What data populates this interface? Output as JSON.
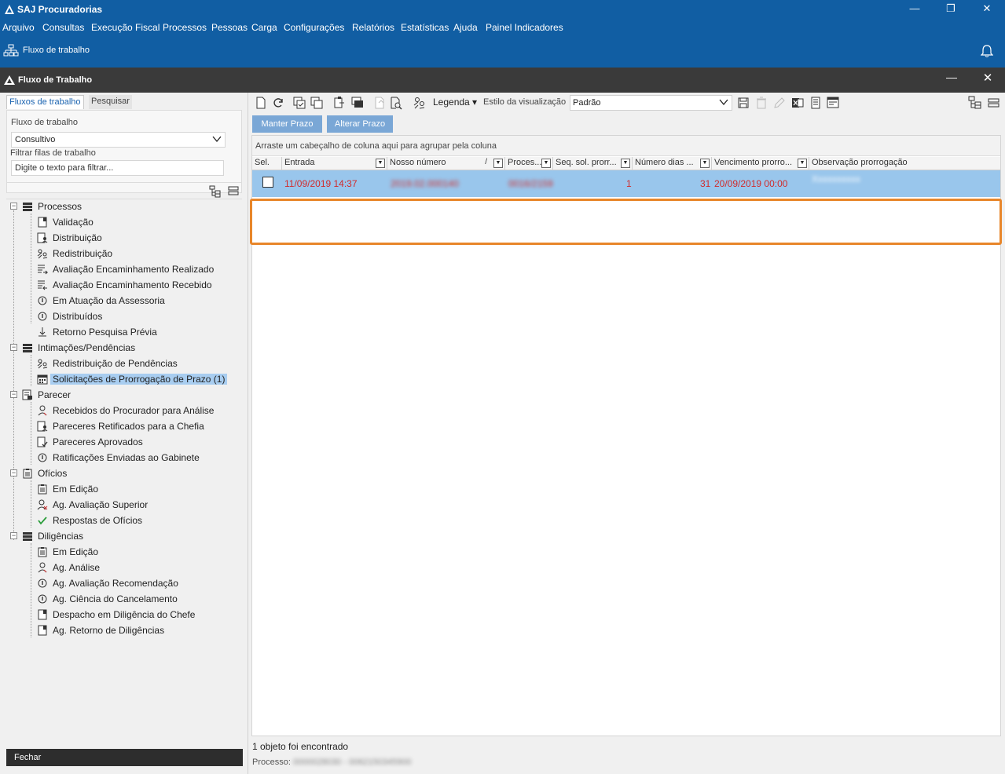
{
  "window": {
    "app_title": "SAJ Procuradorias",
    "minimize": "—",
    "maximize": "❐",
    "close": "✕"
  },
  "menu": [
    "Arquivo",
    "Consultas",
    "Execução Fiscal",
    "Processos",
    "Pessoas",
    "Carga",
    "Configurações",
    "Relatórios",
    "Estatísticas",
    "Ajuda",
    "Painel Indicadores"
  ],
  "strip": {
    "label": "Fluxo de trabalho"
  },
  "inner_window": {
    "title": "Fluxo de Trabalho",
    "minimize": "—",
    "close": "✕"
  },
  "left": {
    "tabs": [
      "Fluxos de trabalho",
      "Pesquisar"
    ],
    "workflow_label": "Fluxo de trabalho",
    "workflow_value": "Consultivo",
    "filter_label": "Filtrar filas de trabalho",
    "filter_placeholder": "Digite o texto para filtrar...",
    "tree": [
      {
        "label": "Processos",
        "level": 0,
        "icon": "list-icon"
      },
      {
        "label": "Validação",
        "level": 1,
        "icon": "document-flag-icon"
      },
      {
        "label": "Distribuição",
        "level": 1,
        "icon": "document-person-icon"
      },
      {
        "label": "Redistribuição",
        "level": 1,
        "icon": "people-swap-icon"
      },
      {
        "label": "Avaliação Encaminhamento Realizado",
        "level": 1,
        "icon": "list-arrow-out-icon"
      },
      {
        "label": "Avaliação Encaminhamento Recebido",
        "level": 1,
        "icon": "list-arrow-in-icon"
      },
      {
        "label": "Em Atuação da Assessoria",
        "level": 1,
        "icon": "info-circle-icon"
      },
      {
        "label": "Distribuídos",
        "level": 1,
        "icon": "info-circle-icon"
      },
      {
        "label": "Retorno Pesquisa Prévia",
        "level": 1,
        "icon": "download-arrow-icon"
      },
      {
        "label": "Intimações/Pendências",
        "level": 0,
        "icon": "list-icon"
      },
      {
        "label": "Redistribuição de Pendências",
        "level": 1,
        "icon": "people-swap-icon"
      },
      {
        "label": "Solicitações de Prorrogação de Prazo (1)",
        "level": 1,
        "icon": "calendar-icon",
        "selected": true
      },
      {
        "label": "Parecer",
        "level": 0,
        "icon": "document-edit-icon"
      },
      {
        "label": "Recebidos do Procurador para Análise",
        "level": 1,
        "icon": "person-icon"
      },
      {
        "label": "Pareceres Retificados para a Chefia",
        "level": 1,
        "icon": "document-person-icon"
      },
      {
        "label": "Pareceres Aprovados",
        "level": 1,
        "icon": "document-check-icon"
      },
      {
        "label": "Ratificações Enviadas ao Gabinete",
        "level": 1,
        "icon": "info-circle-icon"
      },
      {
        "label": "Ofícios",
        "level": 0,
        "icon": "clipboard-icon"
      },
      {
        "label": "Em Edição",
        "level": 1,
        "icon": "clipboard-icon"
      },
      {
        "label": "Ag. Avaliação Superior",
        "level": 1,
        "icon": "person-x-icon"
      },
      {
        "label": "Respostas de Ofícios",
        "level": 1,
        "icon": "checkmark-icon"
      },
      {
        "label": "Diligências",
        "level": 0,
        "icon": "list-icon"
      },
      {
        "label": "Em Edição",
        "level": 1,
        "icon": "clipboard-icon"
      },
      {
        "label": "Ag. Análise",
        "level": 1,
        "icon": "person-icon"
      },
      {
        "label": "Ag. Avaliação Recomendação",
        "level": 1,
        "icon": "info-circle-icon"
      },
      {
        "label": "Ag. Ciência do Cancelamento",
        "level": 1,
        "icon": "info-circle-icon"
      },
      {
        "label": "Despacho em Diligência do Chefe",
        "level": 1,
        "icon": "document-flag-icon"
      },
      {
        "label": "Ag. Retorno de Diligências",
        "level": 1,
        "icon": "document-flag-icon"
      }
    ],
    "close_button": "Fechar"
  },
  "right": {
    "legend_label": "Legenda ▾",
    "style_label": "Estilo da visualização",
    "style_value": "Padrão",
    "buttons": [
      "Manter Prazo",
      "Alterar Prazo"
    ],
    "group_hint": "Arraste um cabeçalho de coluna aqui para agrupar pela coluna",
    "columns": [
      "Sel.",
      "Entrada",
      "Nosso número",
      "Proces...",
      "Seq. sol. prorr...",
      "Número dias ...",
      "Vencimento prorro...",
      "Observação prorrogação"
    ],
    "row": {
      "entrada": "11/09/2019 14:37",
      "nosso_numero": "2019.02.000140",
      "processo": "0016/2159",
      "seq": "1",
      "numero_dias": "31",
      "vencimento": "20/09/2019 00:00",
      "observacao": "Xxxxxxxxxx"
    },
    "status": "1 objeto foi encontrado",
    "process_label": "Processo:",
    "process_value": "0000028030 - 0062150345900"
  },
  "colors": {
    "title_blue": "#115ea3",
    "row_selected": "#99c6ec",
    "highlight": "#e8862a",
    "row_text": "#d12c2c"
  }
}
